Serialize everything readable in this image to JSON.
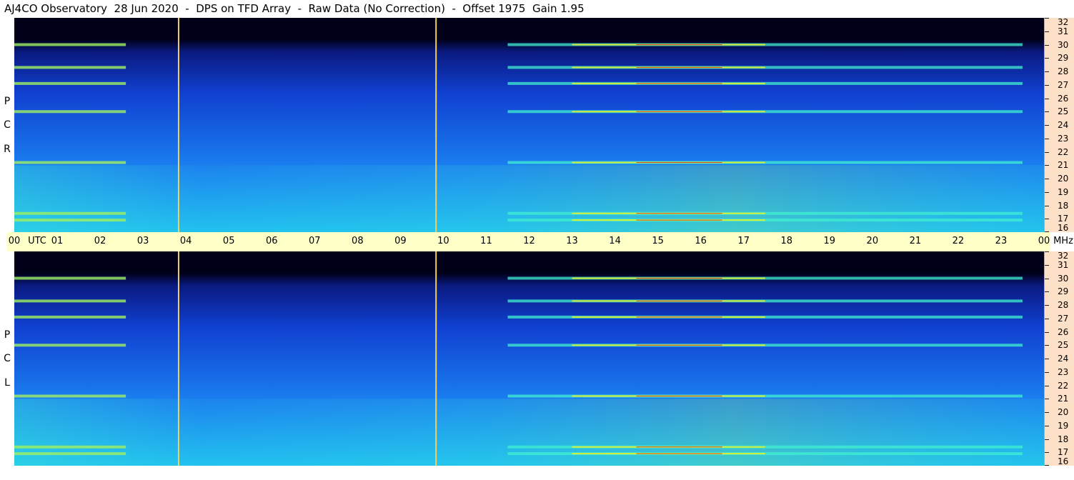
{
  "header": {
    "title": "AJ4CO Observatory  28 Jun 2020  -  DPS on TFD Array  -  Raw Data (No Correction)  -  Offset 1975  Gain 1.95"
  },
  "panels": [
    {
      "id": "rcp",
      "label_letters": [
        "P",
        "C",
        "R"
      ]
    },
    {
      "id": "lcp",
      "label_letters": [
        "P",
        "C",
        "L"
      ]
    }
  ],
  "chart_data": {
    "type": "heatmap",
    "title": "AJ4CO Observatory  28 Jun 2020  -  DPS on TFD Array  -  Raw Data (No Correction)  -  Offset 1975  Gain 1.95",
    "x_axis": {
      "unit_label": "UTC",
      "ticks": [
        "00",
        "01",
        "02",
        "03",
        "04",
        "05",
        "06",
        "07",
        "08",
        "09",
        "10",
        "11",
        "12",
        "13",
        "14",
        "15",
        "16",
        "17",
        "18",
        "19",
        "20",
        "21",
        "22",
        "23",
        "00"
      ],
      "range_hours": [
        0,
        24
      ]
    },
    "y_axis": {
      "unit_label": "MHz",
      "ticks": [
        32,
        31,
        30,
        29,
        28,
        27,
        26,
        25,
        24,
        23,
        22,
        21,
        20,
        19,
        18,
        17,
        16
      ],
      "range_mhz": [
        16,
        32
      ]
    },
    "markers_utc_hours": [
      3.83,
      9.83
    ],
    "colormap": [
      "#000018",
      "#0a1a80",
      "#1040d0",
      "#1a80f0",
      "#20c0f0",
      "#40f0d0",
      "#a0f060",
      "#f0f020",
      "#f08020",
      "#e02020"
    ],
    "background_color": "#1a60e8",
    "series": [
      {
        "name": "RCP",
        "bands_mhz": [
          30.0,
          28.3,
          27.1,
          25.0,
          21.2,
          17.4,
          16.9
        ]
      },
      {
        "name": "LCP",
        "bands_mhz": [
          30.0,
          28.3,
          27.1,
          25.0,
          21.2,
          17.4,
          16.9
        ]
      }
    ]
  }
}
